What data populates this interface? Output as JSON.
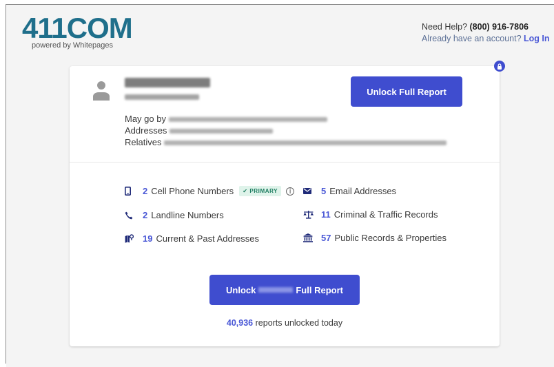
{
  "header": {
    "logo_text": "411COM",
    "logo_sub": "powered by Whitepages",
    "help_label": "Need Help?",
    "help_phone": "(800) 916-7806",
    "account_prompt": "Already have an account?",
    "login_label": "Log In"
  },
  "person": {
    "may_go_by_label": "May go by",
    "addresses_label": "Addresses",
    "relatives_label": "Relatives"
  },
  "buttons": {
    "unlock_top": "Unlock Full Report",
    "unlock_main_prefix": "Unlock",
    "unlock_main_suffix": "Full Report"
  },
  "stats": {
    "cell": {
      "count": "2",
      "label": "Cell Phone Numbers",
      "badge": "✔ PRIMARY"
    },
    "landline": {
      "count": "2",
      "label": "Landline Numbers"
    },
    "addresses": {
      "count": "19",
      "label": "Current & Past Addresses"
    },
    "email": {
      "count": "5",
      "label": "Email Addresses"
    },
    "criminal": {
      "count": "11",
      "label": "Criminal & Traffic Records"
    },
    "public": {
      "count": "57",
      "label": "Public Records & Properties"
    }
  },
  "footer": {
    "reports_count": "40,936",
    "reports_text": "reports unlocked today"
  },
  "colors": {
    "brand": "#1f6f8b",
    "accent": "#3f4dcf",
    "link": "#4a58d6",
    "badge_text": "#1b7c5f",
    "badge_bg": "#dff3ea"
  },
  "icons": {
    "lock": "lock-icon",
    "avatar": "person-icon",
    "cell": "mobile-phone-icon",
    "landline": "phone-handset-icon",
    "addresses": "map-pin-icon",
    "email": "envelope-icon",
    "criminal": "scales-icon",
    "public": "bank-building-icon"
  }
}
